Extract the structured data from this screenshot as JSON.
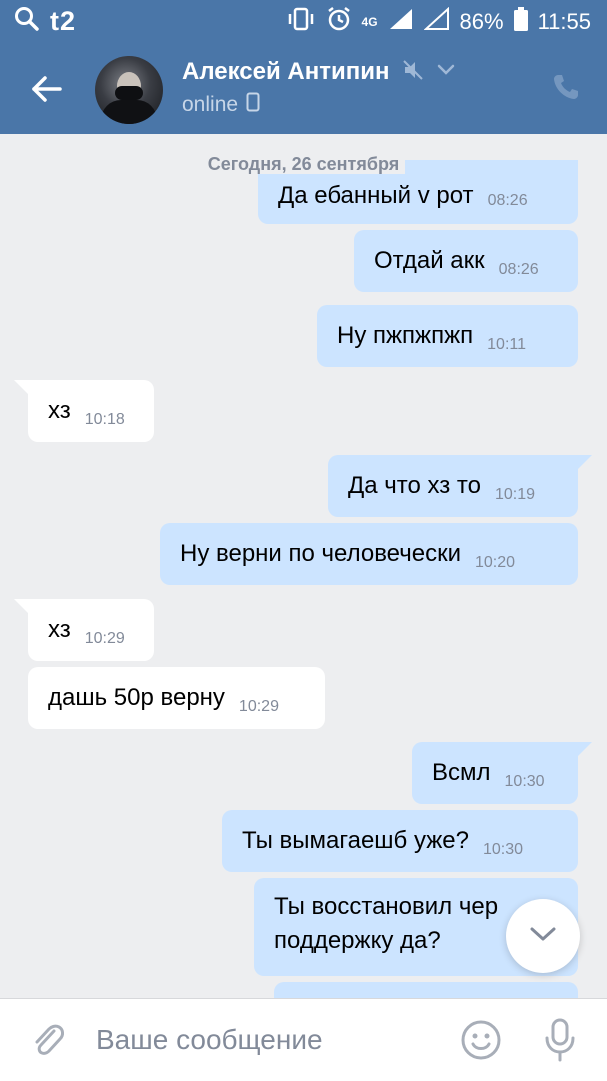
{
  "status_bar": {
    "carrier": "t2",
    "network": "4G",
    "battery": "86%",
    "time": "11:55"
  },
  "header": {
    "contact_name": "Алексей Антипин",
    "status": "online"
  },
  "chat": {
    "date_separator": "Сегодня, 26 сентября",
    "messages": [
      {
        "dir": "out",
        "text": "Да ебанный v рот",
        "time": "08:26"
      },
      {
        "dir": "out",
        "text": "Отдай акк",
        "time": "08:26"
      },
      {
        "dir": "out",
        "text": "Ну пжпжпжп",
        "time": "10:11"
      },
      {
        "dir": "in",
        "text": "хз",
        "time": "10:18"
      },
      {
        "dir": "out",
        "text": "Да что хз то",
        "time": "10:19"
      },
      {
        "dir": "out",
        "text": "Ну верни по человечески",
        "time": "10:20"
      },
      {
        "dir": "in",
        "text": "хз",
        "time": "10:29"
      },
      {
        "dir": "in",
        "text": "дашь 50р верну",
        "time": "10:29"
      },
      {
        "dir": "out",
        "text": "Всмл",
        "time": "10:30"
      },
      {
        "dir": "out",
        "text": "Ты вымагаешб уже?",
        "time": "10:30"
      },
      {
        "dir": "out",
        "text": "Ты восстановил чер поддержку да?",
        "time": ""
      }
    ]
  },
  "input": {
    "placeholder": "Ваше сообщение"
  },
  "colors": {
    "header_bg": "#4a76a8",
    "outgoing_bubble": "#cce4ff",
    "incoming_bubble": "#ffffff",
    "chat_bg": "#edeef0"
  }
}
